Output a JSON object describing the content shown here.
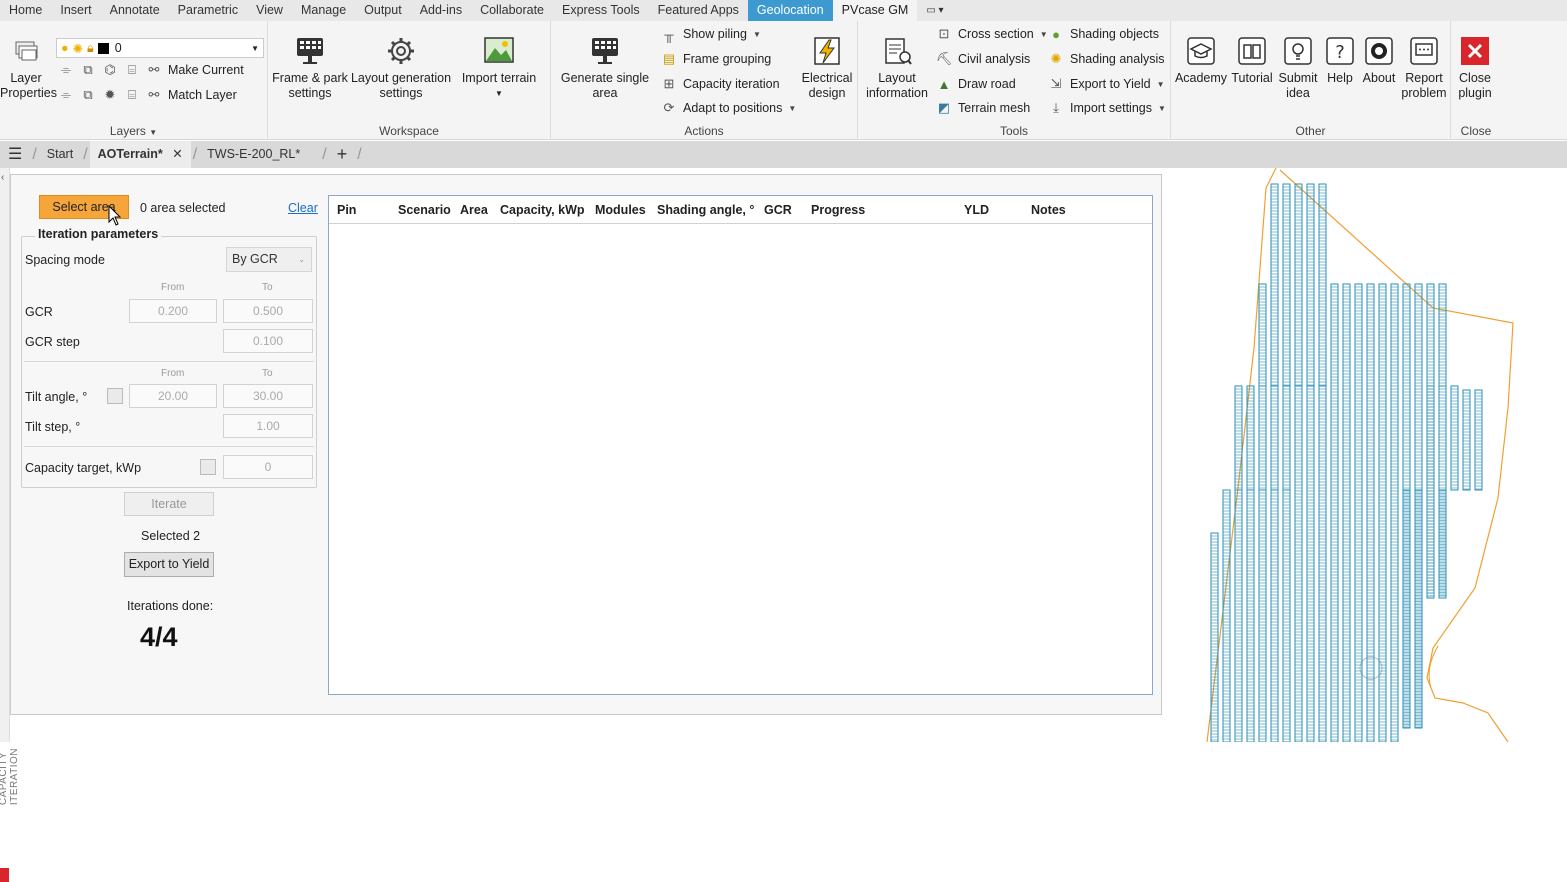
{
  "menubar": [
    "Home",
    "Insert",
    "Annotate",
    "Parametric",
    "View",
    "Manage",
    "Output",
    "Add-ins",
    "Collaborate",
    "Express Tools",
    "Featured Apps",
    "Geolocation",
    "PVcase GM"
  ],
  "ribbon": {
    "layers": {
      "layer_properties": "Layer Properties",
      "layer_value": "0",
      "make_current": "Make Current",
      "match_layer": "Match Layer",
      "title": "Layers"
    },
    "workspace": {
      "frame_park": "Frame & park settings",
      "layout_generation": "Layout generation settings",
      "import_terrain": "Import terrain",
      "title": "Workspace"
    },
    "actions": {
      "generate_single_area": "Generate single area",
      "show_piling": "Show piling",
      "frame_grouping": "Frame grouping",
      "capacity_iteration": "Capacity iteration",
      "adapt_to_positions": "Adapt to positions",
      "electrical_design": "Electrical design",
      "title": "Actions"
    },
    "tools": {
      "layout_information": "Layout information",
      "cross_section": "Cross section",
      "civil_analysis": "Civil analysis",
      "draw_road": "Draw road",
      "terrain_mesh": "Terrain mesh",
      "shading_objects": "Shading objects",
      "shading_analysis": "Shading analysis",
      "export_to_yield": "Export to Yield",
      "import_settings": "Import settings",
      "title": "Tools"
    },
    "other": {
      "academy": "Academy",
      "tutorial": "Tutorial",
      "submit_idea": "Submit idea",
      "help": "Help",
      "about": "About",
      "report_problem": "Report problem",
      "title": "Other"
    },
    "close": {
      "close_plugin": "Close plugin",
      "title": "Close"
    }
  },
  "tabs": {
    "start": "Start",
    "active": "AOTerrain*",
    "other": "TWS-E-200_RL*"
  },
  "panel": {
    "side_label": "CAPACITY ITERATION",
    "select_area": "Select area",
    "area_status": "0 area selected",
    "clear": "Clear",
    "iteration_parameters": "Iteration parameters",
    "spacing_mode_label": "Spacing mode",
    "spacing_mode_value": "By GCR",
    "from": "From",
    "to": "To",
    "gcr_label": "GCR",
    "gcr_from": "0.200",
    "gcr_to": "0.500",
    "gcr_step_label": "GCR step",
    "gcr_step": "0.100",
    "tilt_label": "Tilt angle, °",
    "tilt_from": "20.00",
    "tilt_to": "30.00",
    "tilt_step_label": "Tilt step, °",
    "tilt_step": "1.00",
    "capacity_label": "Capacity target, kWp",
    "capacity_value": "0",
    "iterate": "Iterate",
    "selected": "Selected 2",
    "export_yield": "Export to Yield",
    "iterations_done_label": "Iterations done:",
    "iterations_done": "4/4"
  },
  "table": {
    "columns": [
      "Pin",
      "Scenario",
      "Area",
      "Capacity, kWp",
      "Modules",
      "Shading angle, °",
      "GCR",
      "Progress",
      "YLD",
      "Notes"
    ]
  },
  "colors": {
    "accent": "#f5a53a",
    "geolocation_tab": "#3d9ad1",
    "modules": "#2a8fb8",
    "boundary": "#f0a030"
  }
}
